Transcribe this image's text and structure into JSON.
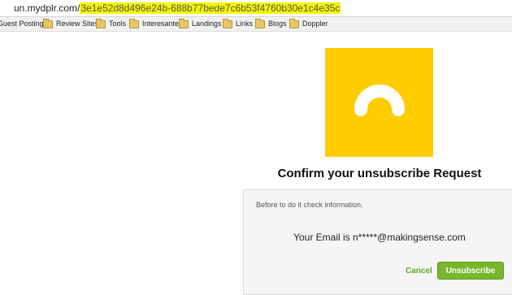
{
  "browser": {
    "url_domain": "un.mydplr.com/",
    "url_path": "3e1e52d8d496e24b-688b77bede7c6b53f4760b30e1c4e35c",
    "bookmarks": [
      {
        "label": "Guest Posting",
        "icon": "folder-icon"
      },
      {
        "label": "Review Sites",
        "icon": "folder-icon"
      },
      {
        "label": "Tools",
        "icon": "folder-icon"
      },
      {
        "label": "Interesante",
        "icon": "folder-icon"
      },
      {
        "label": "Landings",
        "icon": "folder-icon"
      },
      {
        "label": "Links",
        "icon": "folder-icon"
      },
      {
        "label": "Blogs",
        "icon": "folder-icon"
      },
      {
        "label": "Doppler",
        "icon": "folder-icon"
      }
    ]
  },
  "page": {
    "logo": {
      "icon": "doppler-arc-logo",
      "background": "#ffcc00"
    },
    "title": "Confirm your unsubscribe Request",
    "info_text": "Before to do it check information.",
    "email_line": "Your Email is n*****@makingsense.com",
    "cancel_label": "Cancel",
    "unsubscribe_label": "Unsubscribe",
    "accent_color": "#78b72d"
  }
}
